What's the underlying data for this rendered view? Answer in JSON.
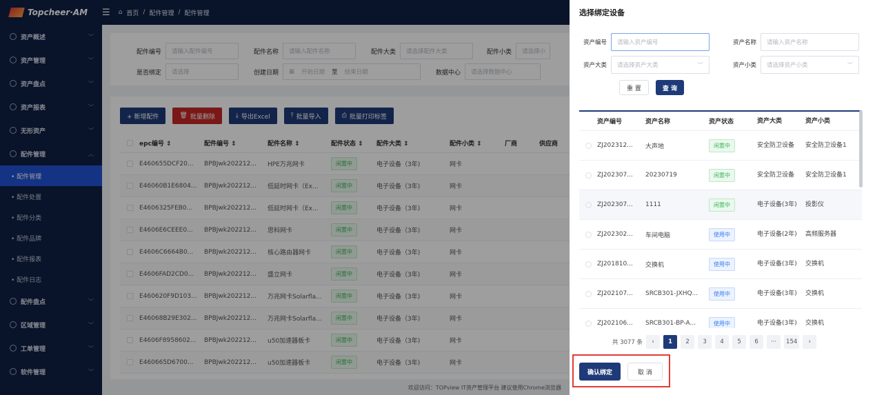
{
  "topbar": {
    "logo": "Topcheer·AM",
    "breadcrumbs": [
      "首页",
      "配件管理",
      "配件管理"
    ],
    "separator": "/"
  },
  "sidebar": {
    "items": [
      {
        "label": "资产概述",
        "chev": "﹀"
      },
      {
        "label": "资产管理",
        "chev": "﹀"
      },
      {
        "label": "资产盘点",
        "chev": "﹀"
      },
      {
        "label": "资产报表",
        "chev": "﹀"
      },
      {
        "label": "无形资产",
        "chev": "﹀"
      },
      {
        "label": "配件管理",
        "chev": "︿"
      }
    ],
    "sub_items": [
      "• 配件管理",
      "• 配件处置",
      "• 配件分类",
      "• 配件品牌",
      "• 配件报表",
      "• 配件日志"
    ],
    "items_after": [
      {
        "label": "配件盘点",
        "chev": "﹀"
      },
      {
        "label": "区域管理",
        "chev": "﹀"
      },
      {
        "label": "工单管理",
        "chev": "﹀"
      },
      {
        "label": "软件管理",
        "chev": "﹀"
      }
    ]
  },
  "filters": {
    "part_no_label": "配件编号",
    "part_no_placeholder": "请输入配件编号",
    "part_name_label": "配件名称",
    "part_name_placeholder": "请输入配件名称",
    "cat_label": "配件大类",
    "cat_placeholder": "请选择配件大类",
    "subcat_label": "配件小类",
    "subcat_placeholder": "请选择小",
    "bound_label": "是否绑定",
    "bound_placeholder": "请选择",
    "created_label": "创建日期",
    "start_placeholder": "开始日期",
    "to": "至",
    "end_placeholder": "结束日期",
    "dc_label": "数据中心",
    "dc_placeholder": "请选择数据中心"
  },
  "toolbar": {
    "add": "+ 新增配件",
    "batch_delete": "批量删除",
    "export": "导出Excel",
    "import": "批量导入",
    "print": "批量打印标签"
  },
  "table": {
    "headers": [
      "epc编号 ⇕",
      "配件编号 ⇕",
      "配件名称 ⇕",
      "配件状态 ⇕",
      "配件大类 ⇕",
      "配件小类 ⇕",
      "厂商",
      "供应商"
    ],
    "rows": [
      {
        "epc": "E460655DCF20...",
        "no": "BPBJwk202212...",
        "name": "HPE万兆网卡",
        "status": "闲置中",
        "cat": "电子设备（3年)",
        "sub": "网卡"
      },
      {
        "epc": "E46060B1E6804...",
        "no": "BPBJwk202212...",
        "name": "低延时网卡（Ex...",
        "status": "闲置中",
        "cat": "电子设备（3年)",
        "sub": "网卡"
      },
      {
        "epc": "E4606325FEB0...",
        "no": "BPBJwk202212...",
        "name": "低延时网卡（Ex...",
        "status": "闲置中",
        "cat": "电子设备（3年)",
        "sub": "网卡"
      },
      {
        "epc": "E4606E6CEEE0...",
        "no": "BPBJwk202212...",
        "name": "思科网卡",
        "status": "闲置中",
        "cat": "电子设备（3年)",
        "sub": "网卡"
      },
      {
        "epc": "E4606C6664B0...",
        "no": "BPBJwk202212...",
        "name": "核心路由器网卡",
        "status": "闲置中",
        "cat": "电子设备（3年)",
        "sub": "网卡"
      },
      {
        "epc": "E4606FAD2CD0...",
        "no": "BPBJwk202212...",
        "name": "盛立网卡",
        "status": "闲置中",
        "cat": "电子设备（3年)",
        "sub": "网卡"
      },
      {
        "epc": "E460620F9D103...",
        "no": "BPBJwk202212...",
        "name": "万兆网卡Solarfla...",
        "status": "闲置中",
        "cat": "电子设备（3年)",
        "sub": "网卡"
      },
      {
        "epc": "E46068B29E302...",
        "no": "BPBJwk202212...",
        "name": "万兆网卡Solarfla...",
        "status": "闲置中",
        "cat": "电子设备（3年)",
        "sub": "网卡"
      },
      {
        "epc": "E4606F8958602...",
        "no": "BPBJwk202212...",
        "name": "u50加速器板卡",
        "status": "闲置中",
        "cat": "电子设备（3年)",
        "sub": "网卡"
      },
      {
        "epc": "E460665D6700...",
        "no": "BPBJwk202212...",
        "name": "u50加速器板卡",
        "status": "闲置中",
        "cat": "电子设备（3年)",
        "sub": "网卡"
      }
    ]
  },
  "footer": {
    "text": "欢迎访问：TOPview IT资产管理平台 建议使用Chrome浏览器"
  },
  "drawer": {
    "title": "选择绑定设备",
    "asset_no_label": "资产编号",
    "asset_no_placeholder": "请输入资产编号",
    "asset_name_label": "资产名称",
    "asset_name_placeholder": "请输入资产名称",
    "asset_cat_label": "资产大类",
    "asset_cat_placeholder": "请选择资产大类",
    "asset_sub_label": "资产小类",
    "asset_sub_placeholder": "请选择资产小类",
    "reset": "重 置",
    "query": "查 询",
    "headers": [
      "资产编号",
      "资产名称",
      "资产状态",
      "资产大类",
      "资产小类"
    ],
    "rows": [
      {
        "no": "ZJ202312...",
        "name": "大声地",
        "status": "闲置中",
        "cat": "安全防卫设备",
        "sub": "安全防卫设备1"
      },
      {
        "no": "ZJ202307...",
        "name": "20230719",
        "status": "闲置中",
        "cat": "安全防卫设备",
        "sub": "安全防卫设备1"
      },
      {
        "no": "ZJ202307...",
        "name": "1111",
        "status": "闲置中",
        "cat": "电子设备(3年)",
        "sub": "投影仪"
      },
      {
        "no": "ZJ202302...",
        "name": "车间电脑",
        "status": "使用中",
        "cat": "电子设备(2年)",
        "sub": "高频服务器"
      },
      {
        "no": "ZJ201810...",
        "name": "交换机",
        "status": "使用中",
        "cat": "电子设备(3年)",
        "sub": "交换机"
      },
      {
        "no": "ZJ202107...",
        "name": "SRCB301-JXHQ...",
        "status": "使用中",
        "cat": "电子设备(3年)",
        "sub": "交换机"
      },
      {
        "no": "ZJ202106...",
        "name": "SRCB301-BP-A...",
        "status": "使用中",
        "cat": "电子设备(3年)",
        "sub": "交换机"
      }
    ],
    "pager": {
      "total": "共 3077 条",
      "prev": "‹",
      "pages": [
        "1",
        "2",
        "3",
        "4",
        "5",
        "6",
        "···",
        "154"
      ],
      "next": "›"
    },
    "confirm": "确认绑定",
    "cancel": "取 消"
  }
}
